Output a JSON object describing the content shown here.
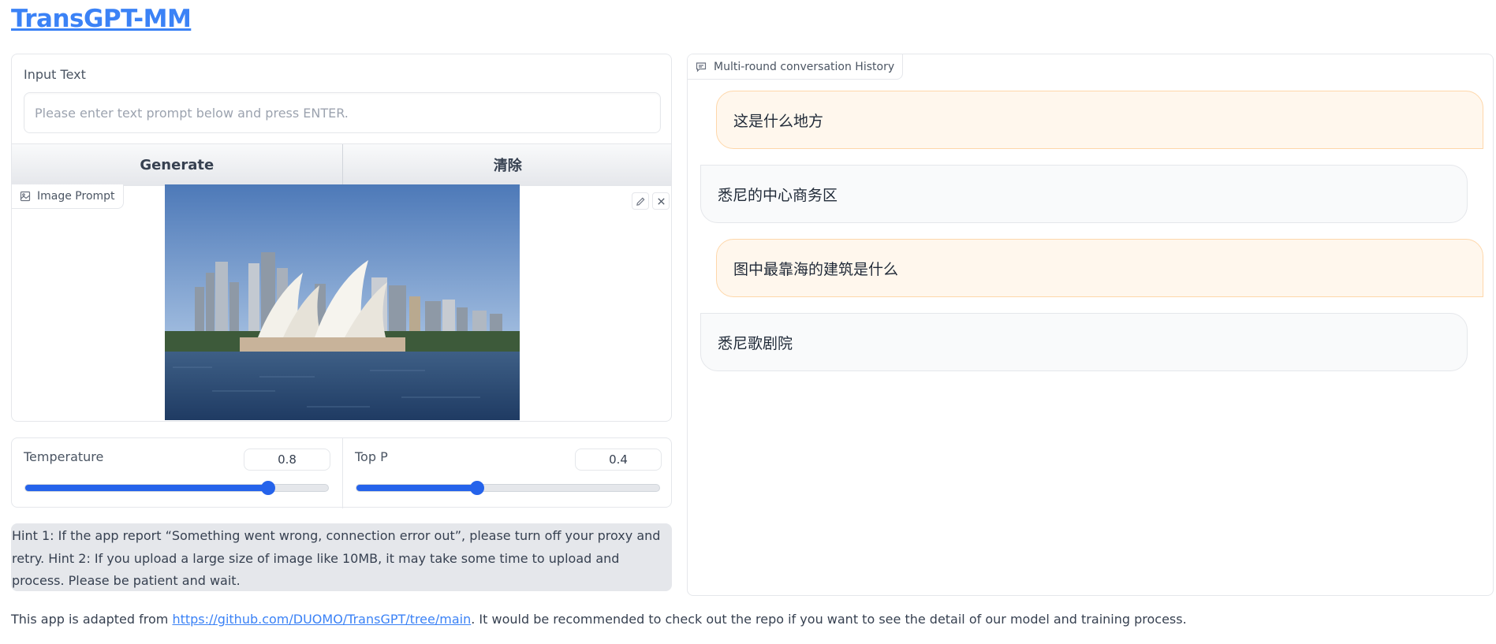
{
  "app": {
    "title": "TransGPT-MM"
  },
  "input": {
    "label": "Input Text",
    "placeholder": "Please enter text prompt below and press ENTER.",
    "value": ""
  },
  "buttons": {
    "generate": "Generate",
    "clear": "清除"
  },
  "image_prompt": {
    "label": "Image Prompt",
    "image_description": "Sydney Opera House and city skyline"
  },
  "sliders": {
    "temperature": {
      "label": "Temperature",
      "value": "0.8",
      "fraction": 0.8
    },
    "top_p": {
      "label": "Top P",
      "value": "0.4",
      "fraction": 0.4
    }
  },
  "hint": "Hint 1: If the app report “Something went wrong, connection error out”, please turn off your proxy and retry. Hint 2: If you upload a large size of image like 10MB, it may take some time to upload and process. Please be patient and wait.",
  "footer": {
    "prefix": "This app is adapted from ",
    "link": "https://github.com/DUOMO/TransGPT/tree/main",
    "suffix": ". It would be recommended to check out the repo if you want to see the detail of our model and training process."
  },
  "chat": {
    "label": "Multi-round conversation History",
    "messages": [
      {
        "role": "user",
        "text": "这是什么地方"
      },
      {
        "role": "bot",
        "text": "悉尼的中心商务区"
      },
      {
        "role": "user",
        "text": "图中最靠海的建筑是什么"
      },
      {
        "role": "bot",
        "text": "悉尼歌剧院"
      }
    ]
  },
  "colors": {
    "accent": "#2563eb",
    "link": "#3b82f6",
    "user_bubble": "#fff7ed",
    "bot_bubble": "#f9fafb"
  }
}
